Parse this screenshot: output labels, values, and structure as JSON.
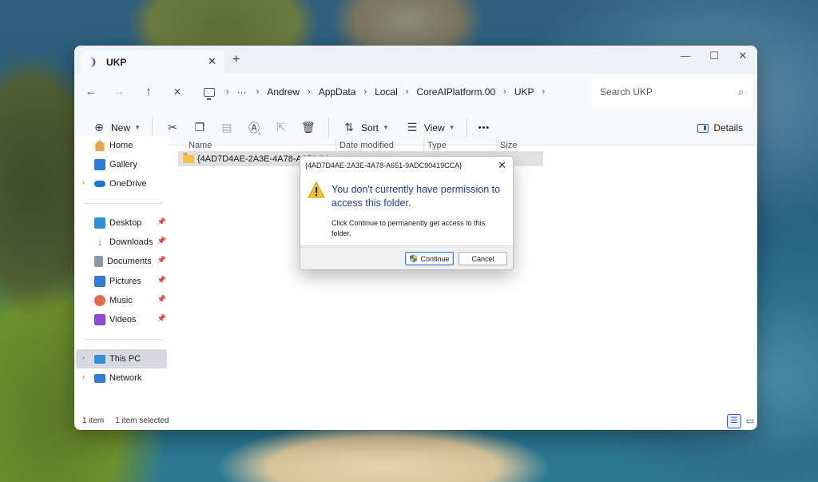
{
  "window": {
    "tab_title": "UKP",
    "tab_close": "✕",
    "new_tab": "+",
    "controls": {
      "minimize": "—",
      "maximize": "☐",
      "close": "✕"
    }
  },
  "address": {
    "back": "←",
    "forward": "→",
    "up": "↑",
    "refresh": "✕",
    "overflow": "···",
    "path": [
      "Andrew",
      "AppData",
      "Local",
      "CoreAIPlatform.00",
      "UKP"
    ],
    "separator": "›",
    "search_placeholder": "Search UKP"
  },
  "toolbar": {
    "new_label": "New",
    "sort_label": "Sort",
    "view_label": "View",
    "more": "•••",
    "details_label": "Details"
  },
  "sidebar": {
    "quick": [
      {
        "label": "Home",
        "color": "#e8a64a"
      },
      {
        "label": "Gallery",
        "color": "#2f7bd6"
      },
      {
        "label": "OneDrive",
        "color": "#1c75d2"
      }
    ],
    "pinned": [
      {
        "label": "Desktop",
        "color": "#2f8fd8"
      },
      {
        "label": "Downloads",
        "color": "#2f7bd6"
      },
      {
        "label": "Documents",
        "color": "#8a9aab"
      },
      {
        "label": "Pictures",
        "color": "#2f7bd6"
      },
      {
        "label": "Music",
        "color": "#e06a4a"
      },
      {
        "label": "Videos",
        "color": "#8c4ad6"
      }
    ],
    "devices": [
      {
        "label": "This PC",
        "color": "#2f8fd8"
      },
      {
        "label": "Network",
        "color": "#2f7bd6"
      }
    ]
  },
  "columns": [
    "Name",
    "Date modified",
    "Type",
    "Size"
  ],
  "files": [
    {
      "name": "{4AD7D4AE-2A3E-4A78-A651-9A"
    }
  ],
  "status": {
    "count": "1 item",
    "selected": "1 item selected"
  },
  "dialog": {
    "title": "{4AD7D4AE-2A3E-4A78-A651-9ADC90419CCA}",
    "close": "✕",
    "heading": "You don't currently have permission to access this folder.",
    "body": "Click Continue to permanently get access to this folder.",
    "continue_label": "Continue",
    "cancel_label": "Cancel"
  }
}
